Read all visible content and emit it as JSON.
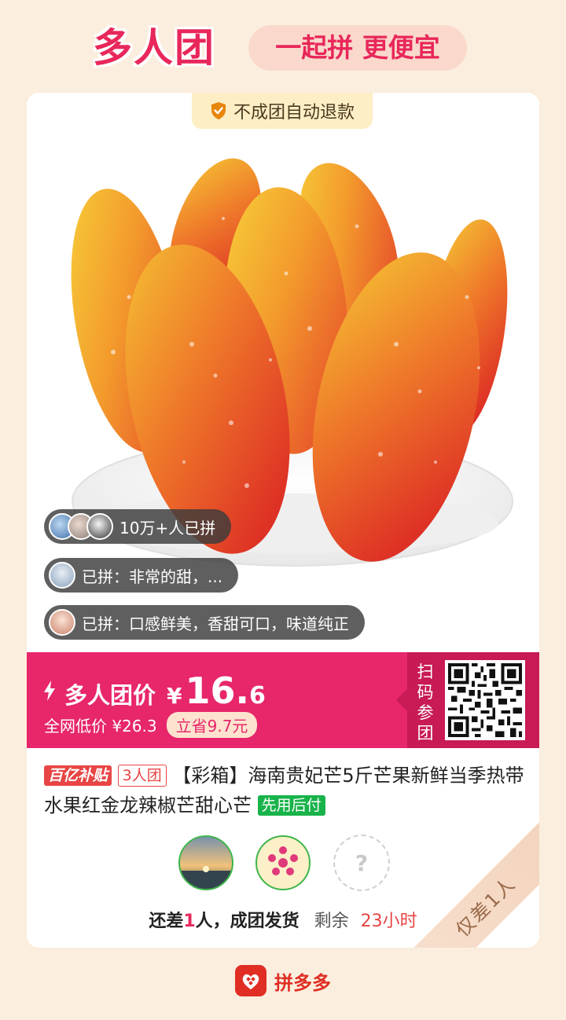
{
  "header": {
    "brand": "多人团",
    "slogan": "一起拼 更便宜"
  },
  "card": {
    "refund_tag": "不成团自动退款",
    "social": {
      "joined_count": "10万+人已拼",
      "review_1": "已拼：非常的甜，...",
      "review_2": "已拼：口感鲜美，香甜可口，味道纯正"
    },
    "price": {
      "label": "多人团价",
      "currency": "¥",
      "integer": "16.",
      "decimal": "6",
      "market_price": "全网低价 ¥26.3",
      "save": "立省9.7元"
    },
    "qr": {
      "scan_label": "扫码参团"
    },
    "product": {
      "tag_subsidy": "百亿补贴",
      "tag_group": "3人团",
      "title": "【彩箱】海南贵妃芒5斤芒果新鲜当季热带水果红金龙辣椒芒甜心芒",
      "tag_pay": "先用后付"
    },
    "group": {
      "unknown_member": "?",
      "status_prefix": "还差",
      "missing_count": "1",
      "status_suffix": "人，成团发货",
      "remain_label": "剩余",
      "remain_time": "23小时",
      "ribbon": "仅差1人"
    }
  },
  "footer": {
    "app_name": "拼多多"
  },
  "colors": {
    "accent": "#e7266b",
    "background": "#fbeede"
  }
}
